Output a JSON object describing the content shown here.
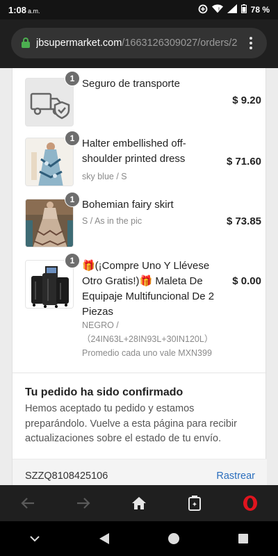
{
  "status": {
    "time": "1:08",
    "ampm": "a.m.",
    "battery": "78 %"
  },
  "browser": {
    "url_domain": "jbsupermarket.com",
    "url_path": "/1663126309027/orders/2"
  },
  "items": [
    {
      "qty": "1",
      "name": "Seguro de transporte",
      "variant": "",
      "price": "$ 9.20",
      "thumb_icon": "truck-shield-icon"
    },
    {
      "qty": "1",
      "name": "Halter embellished off-shoulder printed dress",
      "variant": "sky blue / S",
      "price": "$ 71.60",
      "thumb_icon": "dress-photo"
    },
    {
      "qty": "1",
      "name": "Bohemian fairy skirt",
      "variant": "S / As in the pic",
      "price": "$ 73.85",
      "thumb_icon": "skirt-photo"
    },
    {
      "qty": "1",
      "name": "🎁(¡Compre Uno Y Llévese Otro Gratis!)🎁 Maleta De Equipaje Multifuncional De 2 Piezas",
      "variant": "NEGRO / （24IN63L+28IN93L+30IN120L）Promedio cada uno vale MXN399",
      "price": "$ 0.00",
      "thumb_icon": "luggage-photo"
    }
  ],
  "confirmation": {
    "title": "Tu pedido ha sido confirmado",
    "text": "Hemos aceptado tu pedido y estamos preparándolo. Vuelve a esta página para recibir actualizaciones sobre el estado de tu envío."
  },
  "tracking": {
    "code": "SZZQ8108425106",
    "link": "Rastrear"
  },
  "colors": {
    "link": "#2a6ebd",
    "opera": "#e0141e",
    "secure": "#4caf50"
  }
}
